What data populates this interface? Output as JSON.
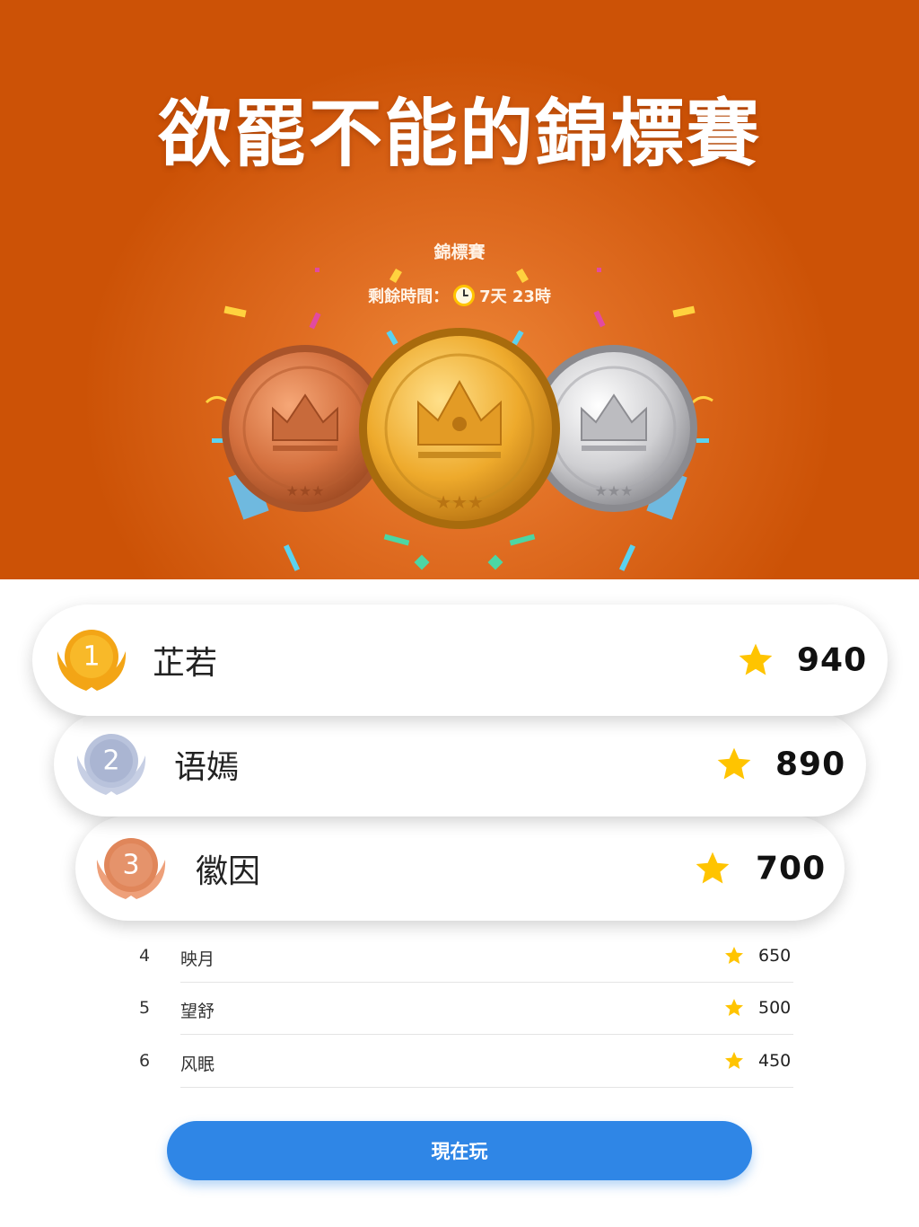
{
  "banner": {
    "headline": "欲罷不能的錦標賽",
    "subtitle": "錦標賽",
    "timer_label": "剩餘時間：",
    "timer_value": "7天 23時",
    "clock_icon": "clock-icon"
  },
  "podium": [
    {
      "rank": "1",
      "name": "芷若",
      "score": "940",
      "badge_color": "#f3a516"
    },
    {
      "rank": "2",
      "name": "语嫣",
      "score": "890",
      "badge_color": "#b9c3dc"
    },
    {
      "rank": "3",
      "name": "徽因",
      "score": "700",
      "badge_color": "#e0865a"
    }
  ],
  "leaderboard": [
    {
      "rank": "4",
      "name": "映月",
      "score": "650"
    },
    {
      "rank": "5",
      "name": "望舒",
      "score": "500"
    },
    {
      "rank": "6",
      "name": "风眠",
      "score": "450"
    }
  ],
  "star_color": "#ffc400",
  "play_button": {
    "label": "現在玩"
  }
}
